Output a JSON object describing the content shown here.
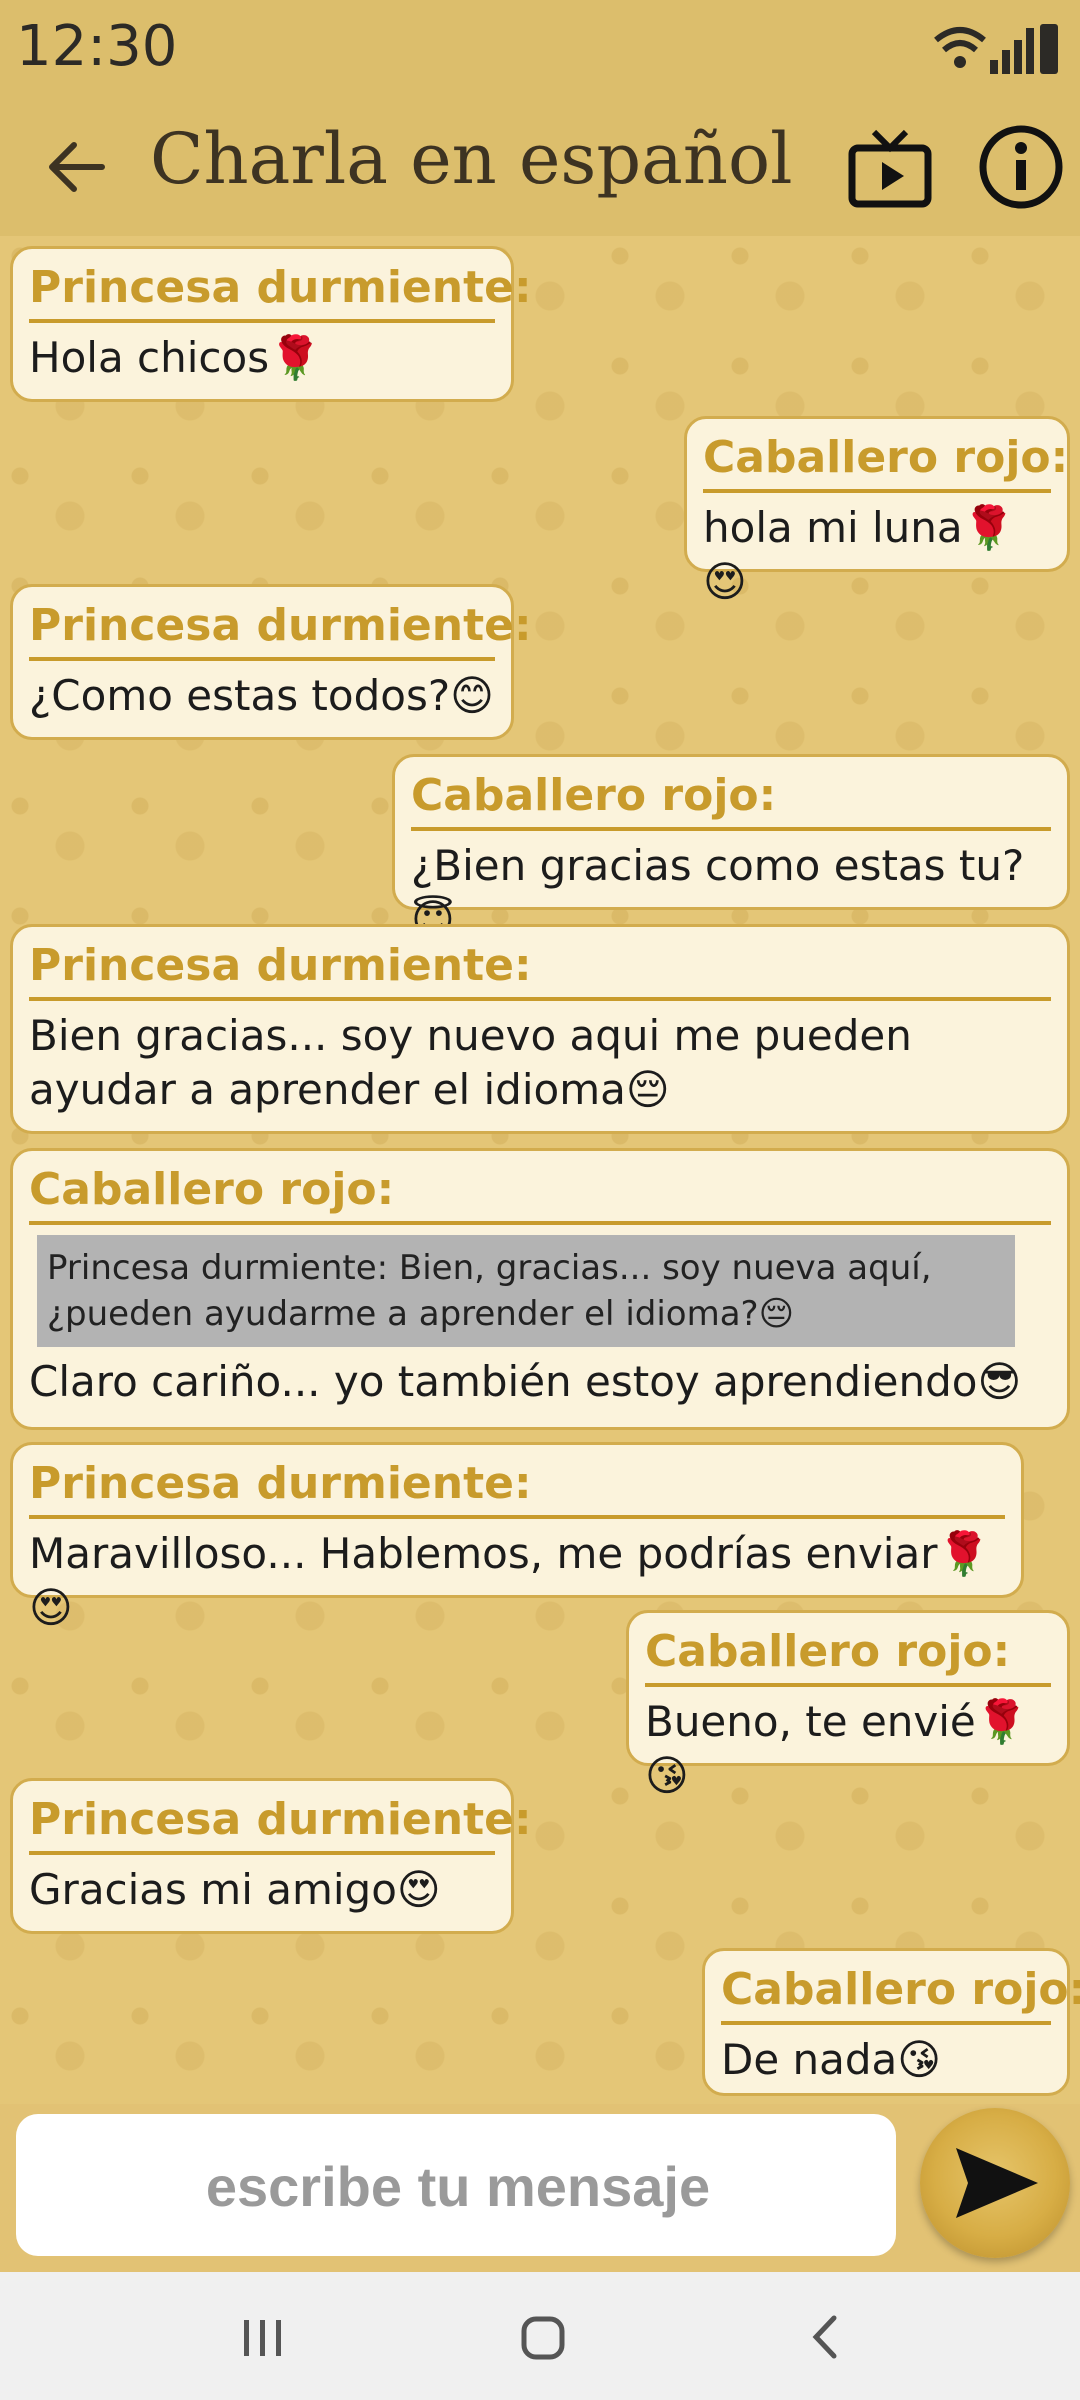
{
  "status": {
    "time": "12:30"
  },
  "header": {
    "title": "Charla en español"
  },
  "messages": [
    {
      "sender": "Princesa durmiente:",
      "text": "Hola chicos🌹"
    },
    {
      "sender": "Caballero rojo:",
      "text": "hola mi luna🌹😍"
    },
    {
      "sender": "Princesa durmiente:",
      "text": "¿Como estas todos?😊"
    },
    {
      "sender": "Caballero rojo:",
      "text": "¿Bien gracias como estas tu?😇"
    },
    {
      "sender": "Princesa durmiente:",
      "text": "Bien gracias... soy nuevo aqui me pueden ayudar a aprender el idioma😔"
    },
    {
      "sender": "Caballero rojo:",
      "quote": "Princesa durmiente: Bien, gracias... soy nueva aquí, ¿pueden ayudarme a aprender el idioma?😔",
      "text": "Claro cariño... yo también estoy aprendiendo😎"
    },
    {
      "sender": "Princesa durmiente:",
      "text": "Maravilloso... Hablemos, me podrías enviar🌹😍"
    },
    {
      "sender": "Caballero rojo:",
      "text": "Bueno, te envié🌹😘"
    },
    {
      "sender": "Princesa durmiente:",
      "text": "Gracias mi amigo😍"
    },
    {
      "sender": "Caballero rojo:",
      "text": "De nada😘"
    }
  ],
  "input": {
    "placeholder": "escribe tu mensaje"
  },
  "icons": {
    "back": "arrow-back-icon",
    "tv": "tv-icon",
    "info": "info-icon",
    "send": "send-icon",
    "nav_recent": "recent-apps-icon",
    "nav_home": "home-icon",
    "nav_back": "nav-back-icon"
  },
  "colors": {
    "background": "#e2c274",
    "bubble": "#fbf3dc",
    "sender": "#c89b2c",
    "quote_bg": "#b3b3b3"
  }
}
